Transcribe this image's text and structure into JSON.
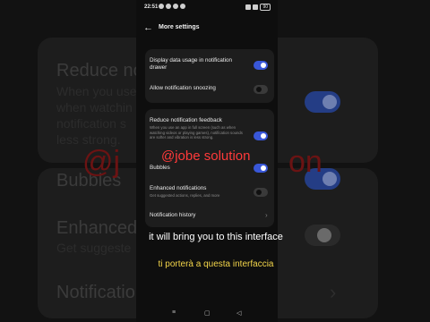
{
  "status_bar": {
    "time": "22:51",
    "battery": "90"
  },
  "header": {
    "title": "More settings"
  },
  "card1": [
    {
      "title": "Display data usage in notification drawer",
      "on": true
    },
    {
      "title": "Allow notification snoozing",
      "on": false
    }
  ],
  "card2": {
    "reduce": {
      "title": "Reduce notification feedback",
      "desc": "When you use an app in full screen (such as when watching videos or playing games), notification sounds are softer and vibration is less strong.",
      "on": true
    },
    "bubbles": {
      "title": "Bubbles",
      "on": true
    },
    "enhanced": {
      "title": "Enhanced notifications",
      "desc": "Get suggested actions, replies, and more",
      "on": false
    },
    "history": {
      "title": "Notification history"
    }
  },
  "watermark": "@jobe solution",
  "captions": {
    "english": "it will bring you to this interface",
    "italian": "ti porterà a questa interfaccia"
  },
  "background": {
    "reduce": "Reduce no",
    "reduce_desc": [
      "When you use",
      "when watchin",
      "notification s",
      "less strong."
    ],
    "bubbles": "Bubbles",
    "enhanced": "Enhanced",
    "enhanced_desc": "Get suggeste",
    "history": "Notificatio",
    "watermark_left": "@j",
    "watermark_right": "on"
  },
  "colors": {
    "accent": "#3957d8",
    "caption_yellow": "#f3d54a",
    "watermark_red": "#ff3a3a"
  },
  "icons": {
    "back": "back-arrow-icon",
    "chevron": "chevron-right-icon",
    "nav": [
      "recents-icon",
      "home-icon",
      "back-triangle-icon"
    ]
  }
}
